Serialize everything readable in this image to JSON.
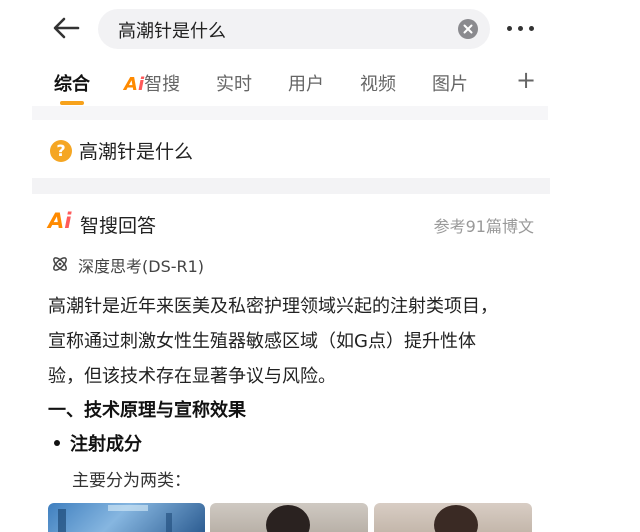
{
  "search": {
    "query": "高潮针是什么"
  },
  "tabs": [
    {
      "label": "综合"
    },
    {
      "label": "智搜",
      "badge_a": "A",
      "badge_i": "i"
    },
    {
      "label": "实时"
    },
    {
      "label": "用户"
    },
    {
      "label": "视频"
    },
    {
      "label": "图片"
    }
  ],
  "tabs_more": "+",
  "question": {
    "icon_char": "?",
    "text": "高潮针是什么"
  },
  "answer": {
    "logo_a": "A",
    "logo_i": "i",
    "title": "智搜回答",
    "references": "参考91篇博文",
    "mode": "深度思考(DS-R1)",
    "paragraph_lines": [
      "高潮针是近年来医美及私密护理领域兴起的注射类项目，",
      "宣称通过刺激女性生殖器敏感区域（如G点）提升性体",
      "验，但该技术存在显著争议与风险。"
    ],
    "section_heading": "一、技术原理与宣称效果",
    "bullet": "注射成分",
    "sub_text": "主要分为两类："
  },
  "colors": {
    "accent": "#f7a21b",
    "ai_orange": "#ff8a00",
    "ai_red": "#ff5a5a",
    "question_icon": "#f5a623"
  },
  "icons": [
    "back-arrow-icon",
    "clear-icon",
    "more-dots-icon",
    "plus-icon",
    "question-icon",
    "deep-think-icon"
  ]
}
